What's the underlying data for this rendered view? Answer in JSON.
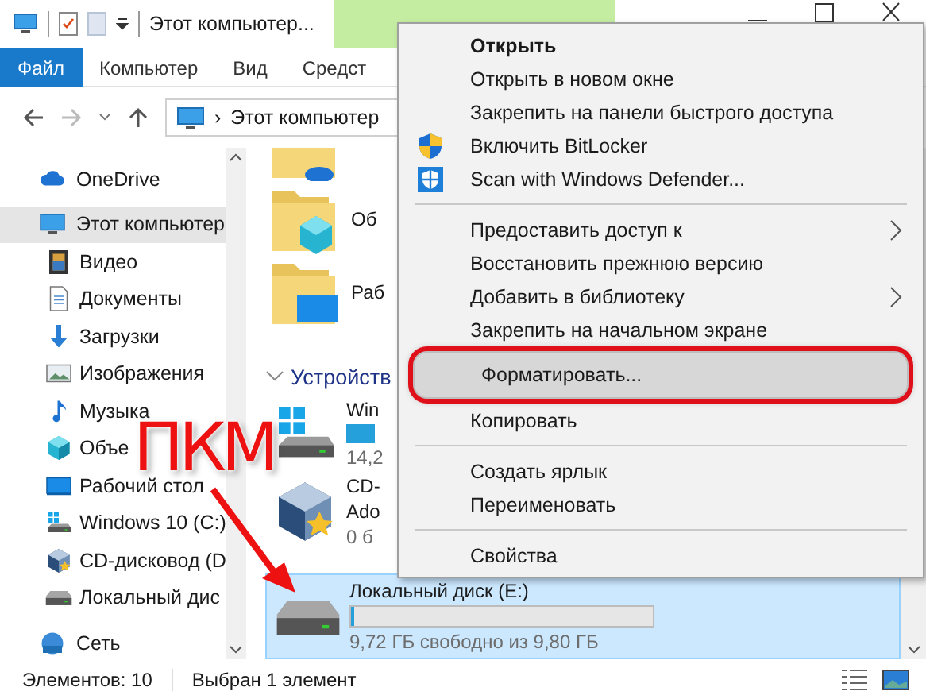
{
  "title_bar": {
    "title": "Этот компьютер..."
  },
  "ribbon_tabs": [
    {
      "label": "Файл",
      "selected": true
    },
    {
      "label": "Компьютер",
      "selected": false
    },
    {
      "label": "Вид",
      "selected": false
    },
    {
      "label": "Средст",
      "selected": false
    }
  ],
  "address_bar": {
    "separator": "›",
    "path": "Этот компьютер"
  },
  "sidebar": {
    "items": [
      {
        "kind": "cloud",
        "label": "OneDrive",
        "selected": false
      },
      {
        "kind": "pc",
        "label": "Этот компьютер",
        "selected": true,
        "children": [
          {
            "kind": "video",
            "label": "Видео",
            "selected": false
          },
          {
            "kind": "docs",
            "label": "Документы",
            "selected": false
          },
          {
            "kind": "download",
            "label": "Загрузки",
            "selected": false
          },
          {
            "kind": "pictures",
            "label": "Изображения",
            "selected": false
          },
          {
            "kind": "music",
            "label": "Музыка",
            "selected": false
          },
          {
            "kind": "cube",
            "label": "Объе",
            "selected": false
          },
          {
            "kind": "desktop",
            "label": "Рабочий стол",
            "selected": false
          },
          {
            "kind": "windrive",
            "label": "Windows 10 (C:)",
            "selected": false
          },
          {
            "kind": "cd",
            "label": "CD-дисковод (D",
            "selected": false
          },
          {
            "kind": "drive",
            "label": "Локальный дис",
            "selected": false
          }
        ]
      },
      {
        "kind": "network",
        "label": "Сеть",
        "selected": false
      }
    ]
  },
  "content": {
    "folders": [
      {
        "kind": "cloud"
      },
      {
        "kind": "cube",
        "name": "Об"
      },
      {
        "kind": "desktop",
        "name": "Раб"
      }
    ],
    "section": "Устройств",
    "drives": [
      {
        "kind": "windrive",
        "name": "Win",
        "detail": "14,2",
        "selected": false
      },
      {
        "kind": "cd",
        "name": "CD-",
        "subtitle": "Ado",
        "detail": "0 б",
        "selected": false
      },
      {
        "kind": "drive",
        "name": "Локальный диск (E:)",
        "level": 0.01,
        "detail": "9,72 ГБ свободно из 9,80 ГБ",
        "selected": true
      }
    ]
  },
  "context_menu": {
    "items": [
      {
        "kind": "item",
        "label": "Открыть",
        "bold": true,
        "selected": false
      },
      {
        "kind": "item",
        "label": "Открыть в новом окне",
        "selected": false
      },
      {
        "kind": "item",
        "label": "Закрепить на панели быстрого доступа",
        "selected": false
      },
      {
        "kind": "bitlocker",
        "label": "Включить BitLocker",
        "selected": false
      },
      {
        "kind": "defender",
        "label": "Scan with Windows Defender...",
        "selected": false
      },
      {
        "kind": "separator"
      },
      {
        "kind": "item",
        "label": "Предоставить доступ к",
        "submenu": true,
        "selected": false
      },
      {
        "kind": "item",
        "label": "Восстановить прежнюю версию",
        "selected": false
      },
      {
        "kind": "item",
        "label": "Добавить в библиотеку",
        "submenu": true,
        "selected": false
      },
      {
        "kind": "item",
        "label": "Закрепить на начальном экране",
        "selected": false
      },
      {
        "kind": "item",
        "label": "Форматировать...",
        "selected": true,
        "outlined": true
      },
      {
        "kind": "item",
        "label": "Копировать",
        "selected": false
      },
      {
        "kind": "separator"
      },
      {
        "kind": "item",
        "label": "Создать ярлык",
        "selected": false
      },
      {
        "kind": "item",
        "label": "Переименовать",
        "selected": false
      },
      {
        "kind": "separator"
      },
      {
        "kind": "item",
        "label": "Свойства",
        "selected": false
      }
    ]
  },
  "annotation": {
    "label": "ПКМ"
  },
  "status_bar": {
    "count": "Элементов: 10",
    "selection": "Выбран 1 элемент"
  }
}
